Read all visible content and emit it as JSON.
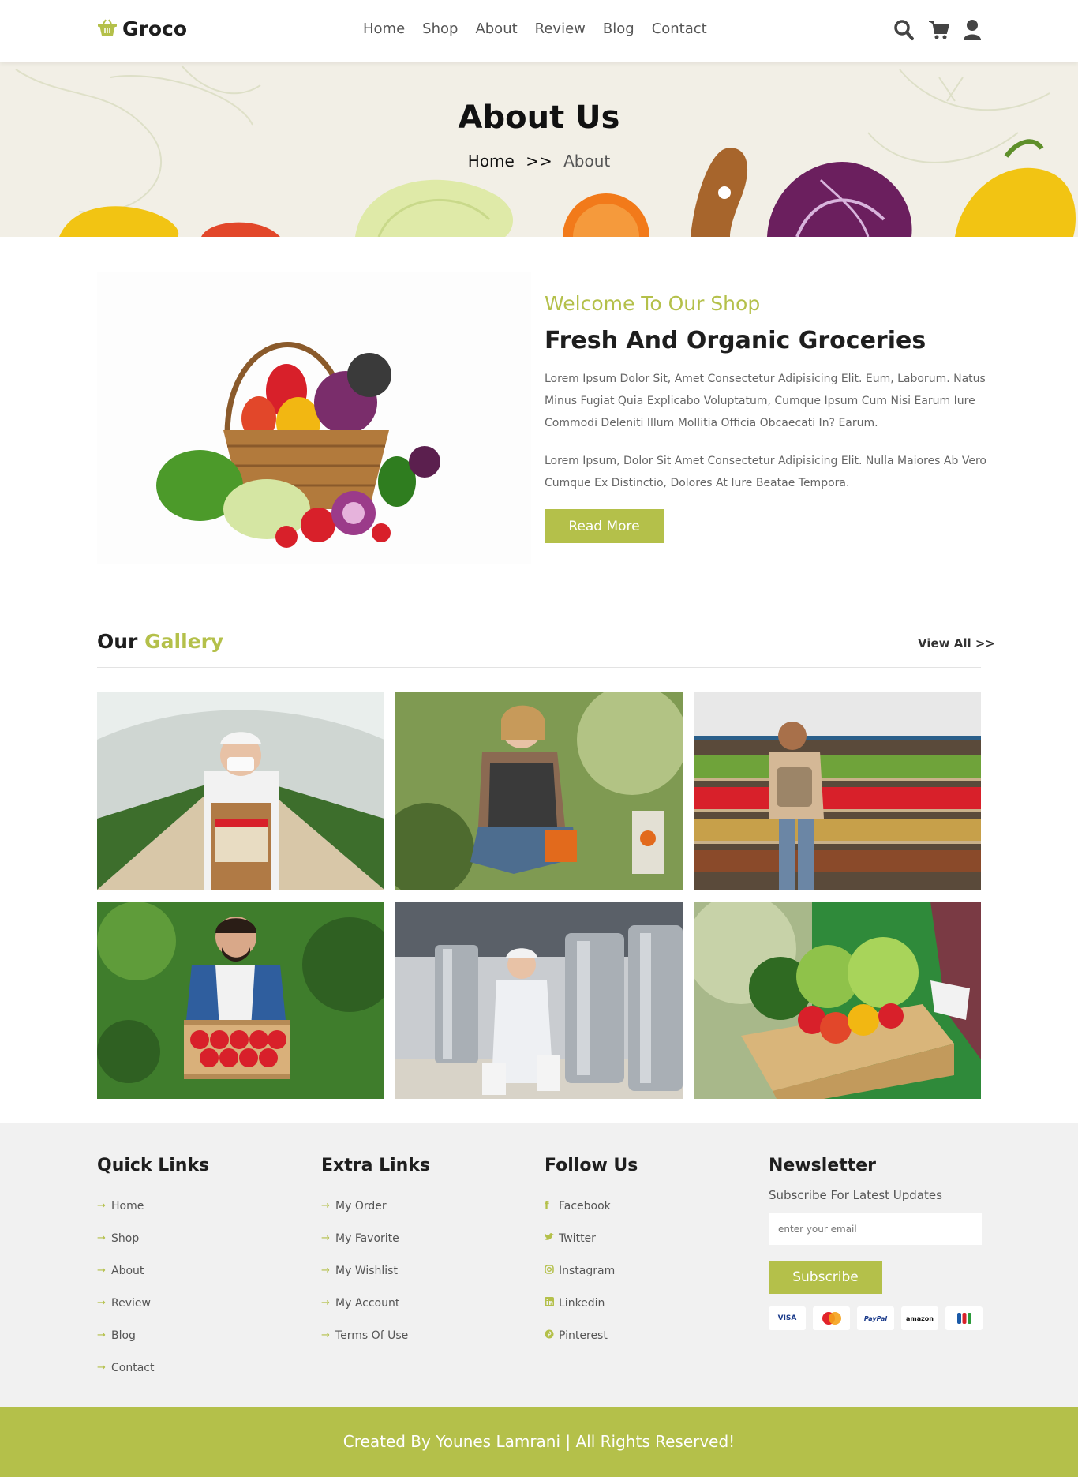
{
  "header": {
    "logo": "Groco",
    "nav": [
      "Home",
      "Shop",
      "About",
      "Review",
      "Blog",
      "Contact"
    ],
    "icons": [
      "search-icon",
      "cart-icon",
      "user-icon"
    ]
  },
  "hero": {
    "title": "About Us",
    "breadcrumb_home": "Home",
    "breadcrumb_sep": ">>",
    "breadcrumb_current": "About"
  },
  "about": {
    "subtitle": "Welcome To Our Shop",
    "title": "Fresh And Organic Groceries",
    "paragraph1": "Lorem Ipsum Dolor Sit, Amet Consectetur Adipisicing Elit. Eum, Laborum. Natus Minus Fugiat Quia Explicabo Voluptatum, Cumque Ipsum Cum Nisi Earum Iure Commodi Deleniti Illum Mollitia Officia Obcaecati In? Earum.",
    "paragraph2": "Lorem Ipsum, Dolor Sit Amet Consectetur Adipisicing Elit. Nulla Maiores Ab Vero Cumque Ex Distinctio, Dolores At Iure Beatae Tempora.",
    "button": "Read More"
  },
  "gallery": {
    "title_plain": "Our",
    "title_accent": "Gallery",
    "view_all": "View All >>"
  },
  "footer": {
    "quick": {
      "title": "Quick Links",
      "links": [
        "Home",
        "Shop",
        "About",
        "Review",
        "Blog",
        "Contact"
      ]
    },
    "extra": {
      "title": "Extra Links",
      "links": [
        "My Order",
        "My Favorite",
        "My Wishlist",
        "My Account",
        "Terms Of Use"
      ]
    },
    "follow": {
      "title": "Follow Us",
      "links": [
        "Facebook",
        "Twitter",
        "Instagram",
        "Linkedin",
        "Pinterest"
      ]
    },
    "newsletter": {
      "title": "Newsletter",
      "subtitle": "Subscribe For Latest Updates",
      "placeholder": "enter your email",
      "button": "Subscribe",
      "cards": [
        "VISA",
        "mastercard-icon",
        "PayPal",
        "amazon",
        "jcb-icon"
      ]
    }
  },
  "copyright": "Created By Younes Lamrani | All Rights Reserved!",
  "colors": {
    "accent": "#b4c04a",
    "dark": "#1e1e1e"
  }
}
